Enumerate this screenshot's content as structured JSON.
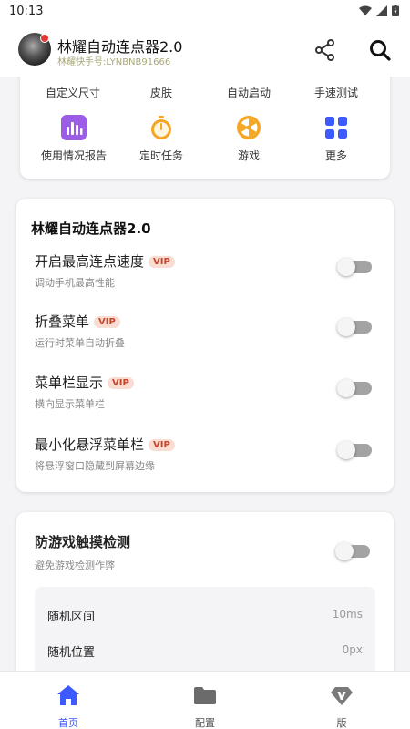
{
  "status_bar": {
    "time": "10:13"
  },
  "header": {
    "title": "林耀自动连点器2.0",
    "subtitle": "林耀快手号:LYNBNB91666"
  },
  "top_card": {
    "row1": [
      "自定义尺寸",
      "皮肤",
      "自动启动",
      "手速测试"
    ],
    "grid": [
      {
        "label": "使用情况报告",
        "icon": "bar-chart-icon",
        "color": "#9b5de5"
      },
      {
        "label": "定时任务",
        "icon": "stopwatch-icon",
        "color": "#f5a623"
      },
      {
        "label": "游戏",
        "icon": "wheel-icon",
        "color": "#f5a623"
      },
      {
        "label": "更多",
        "icon": "apps-grid-icon",
        "color": "#3d5afe"
      }
    ]
  },
  "settings_card": {
    "title": "林耀自动连点器2.0",
    "vip_label": "VIP",
    "items": [
      {
        "label": "开启最高连点速度",
        "desc": "调动手机最高性能",
        "enabled": false
      },
      {
        "label": "折叠菜单",
        "desc": "运行时菜单自动折叠",
        "enabled": false
      },
      {
        "label": "菜单栏显示",
        "desc": "横向显示菜单栏",
        "enabled": false
      },
      {
        "label": "最小化悬浮菜单栏",
        "desc": "将悬浮窗口隐藏到屏幕边缘",
        "enabled": false
      }
    ]
  },
  "anti_detect": {
    "title": "防游戏触摸检测",
    "desc": "避免游戏检测作弊",
    "enabled": false,
    "rows": [
      {
        "label": "随机区间",
        "value": "10ms"
      },
      {
        "label": "随机位置",
        "value": "0px"
      }
    ]
  },
  "bottom_nav": {
    "items": [
      {
        "label": "首页",
        "icon": "home-icon",
        "active": true
      },
      {
        "label": "配置",
        "icon": "folder-icon",
        "active": false
      },
      {
        "label": "版",
        "icon": "vip-diamond-icon",
        "active": false
      }
    ],
    "active_color": "#3d5afe",
    "inactive_color": "#555555"
  }
}
